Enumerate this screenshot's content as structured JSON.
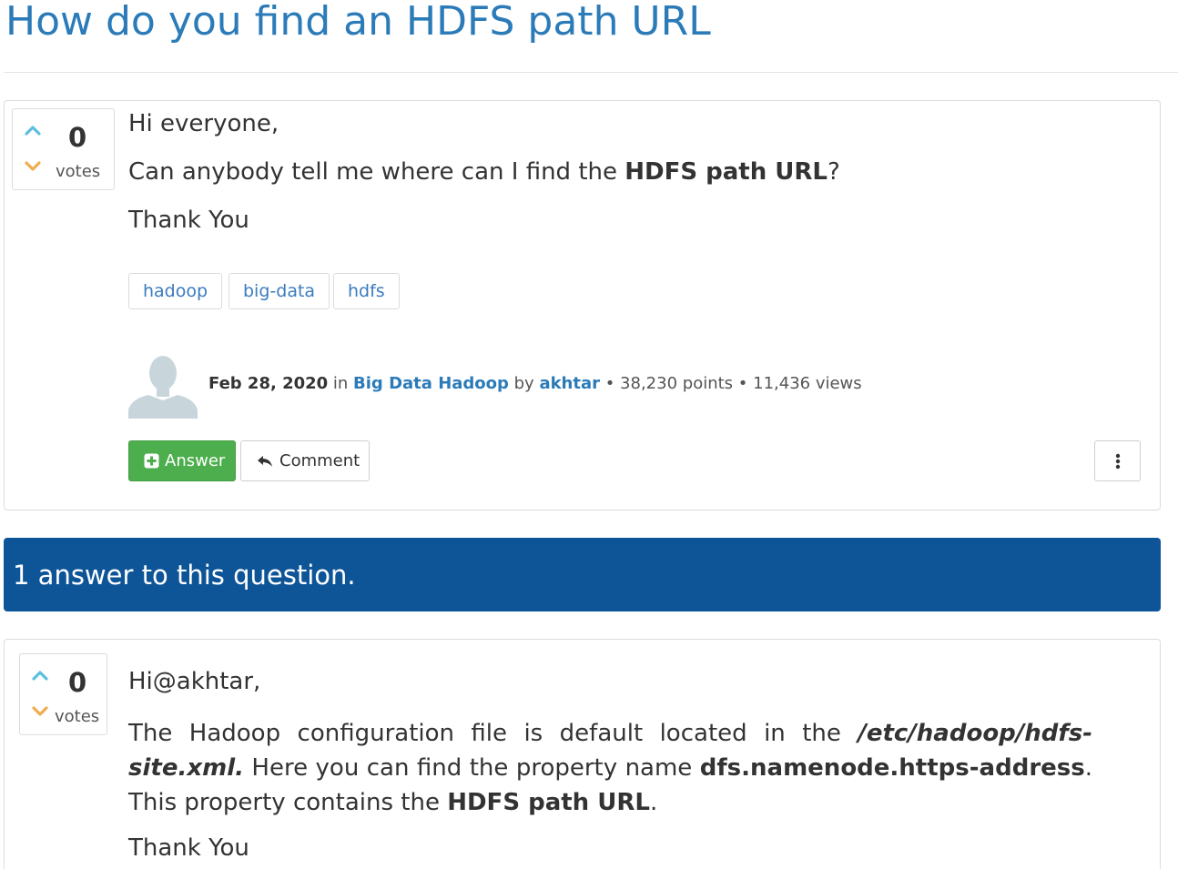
{
  "question": {
    "title": "How do you find an HDFS path URL",
    "votes": "0",
    "votes_label": "votes",
    "greeting": "Hi everyone,",
    "line2_pre": "Can anybody tell me where can I find the ",
    "line2_bold": "HDFS path URL",
    "line2_post": "?",
    "closing": "Thank You",
    "tags": [
      "hadoop",
      "big-data",
      "hdfs"
    ],
    "meta": {
      "date": "Feb 28, 2020",
      "in_word": " in ",
      "category": "Big Data Hadoop",
      "by_word": " by ",
      "author": "akhtar",
      "points": " • 38,230 points",
      "views": " • 11,436 views"
    },
    "answer_button": "Answer",
    "comment_button": "Comment"
  },
  "answers_header": "1 answer to this question.",
  "answer": {
    "votes": "0",
    "votes_label": "votes",
    "greeting": "Hi@akhtar,",
    "p1": "The Hadoop configuration file is default located in the ",
    "p1_path": "/etc/hadoop/hdfs-site.xml.",
    "p2": " Here you can find the property name ",
    "p2_prop": "dfs.namenode.https-address",
    "p3": ". This property contains the ",
    "p3_bold": "HDFS path URL",
    "p3_end": ".",
    "closing": "Thank You"
  },
  "colors": {
    "title": "#2b7bb9",
    "vote_up": "#5bc0de",
    "vote_down": "#f0ad4e",
    "answer_btn": "#4cae4c",
    "header_bg": "#0e5598"
  },
  "icons": {
    "vote_up": "chevron-up-icon",
    "vote_down": "chevron-down-icon",
    "answer": "plus-square-icon",
    "comment": "reply-icon",
    "more": "vertical-ellipsis-icon",
    "avatar": "user-silhouette-icon"
  }
}
